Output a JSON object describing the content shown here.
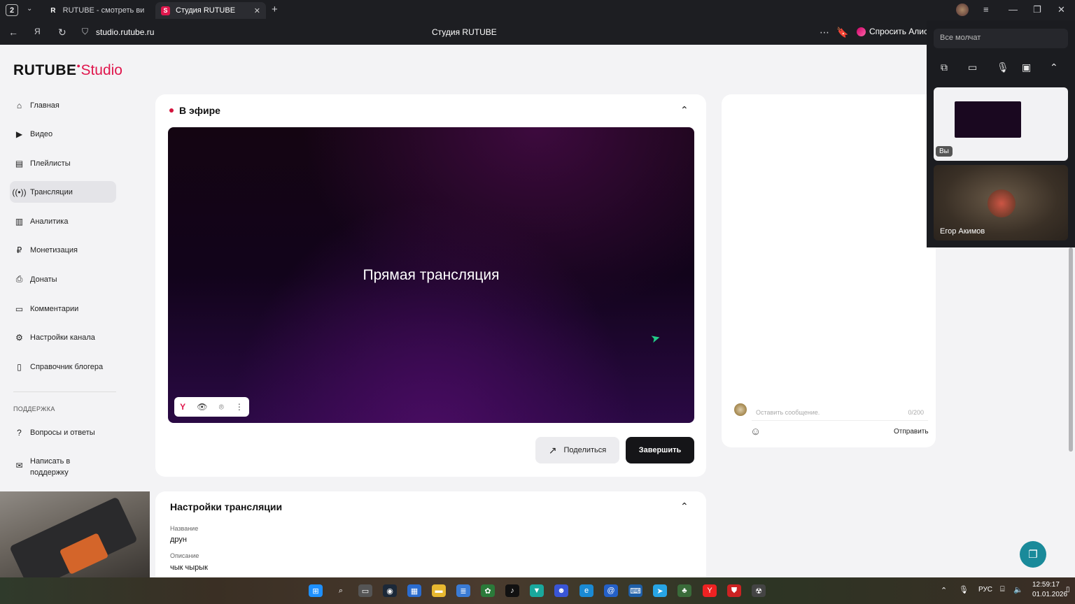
{
  "browser": {
    "tab_count": "2",
    "tabs": [
      {
        "icon": "R",
        "label": "RUTUBE - смотреть виде"
      },
      {
        "icon": "S",
        "label": "Студия RUTUBE"
      }
    ],
    "url": "studio.rutube.ru",
    "page_title": "Студия RUTUBE",
    "alice_label": "Спросить Алис"
  },
  "logo": {
    "brand": "RUTUBE",
    "suffix": "Studio"
  },
  "sidebar": {
    "items": [
      {
        "icon": "home-icon",
        "label": "Главная"
      },
      {
        "icon": "video-icon",
        "label": "Видео"
      },
      {
        "icon": "playlist-icon",
        "label": "Плейлисты"
      },
      {
        "icon": "broadcast-icon",
        "label": "Трансляции",
        "active": true
      },
      {
        "icon": "analytics-icon",
        "label": "Аналитика"
      },
      {
        "icon": "monetization-icon",
        "label": "Монетизация"
      },
      {
        "icon": "donate-icon",
        "label": "Донаты"
      },
      {
        "icon": "comment-icon",
        "label": "Комментарии"
      },
      {
        "icon": "settings-icon",
        "label": "Настройки канала"
      },
      {
        "icon": "book-icon",
        "label": "Справочник блогера"
      }
    ],
    "support_title": "ПОДДЕРЖКА",
    "support_items": [
      {
        "icon": "faq-icon",
        "label": "Вопросы и ответы"
      },
      {
        "icon": "mail-icon",
        "label": "Написать в поддержку"
      }
    ]
  },
  "live": {
    "title": "В эфире",
    "player_text": "Прямая трансляция",
    "share_label": "Поделиться",
    "end_label": "Завершить"
  },
  "chat": {
    "placeholder": "Оставить сообщение.",
    "counter": "0/200",
    "send_label": "Отправить"
  },
  "settings": {
    "title": "Настройки трансляции",
    "name_label": "Название",
    "name_value": "друн",
    "desc_label": "Описание",
    "desc_value": "чык чырык"
  },
  "meet": {
    "status": "Все молчат",
    "self_label": "Вы",
    "participant_name": "Егор Акимов"
  },
  "taskbar": {
    "lang": "РУС",
    "time": "12:59:17",
    "date": "01.01.2026"
  },
  "colors": {
    "accent": "#e0174d",
    "dark_button": "#151518",
    "live_dot": "#d3143d",
    "help_fab": "#1a8a9a"
  }
}
